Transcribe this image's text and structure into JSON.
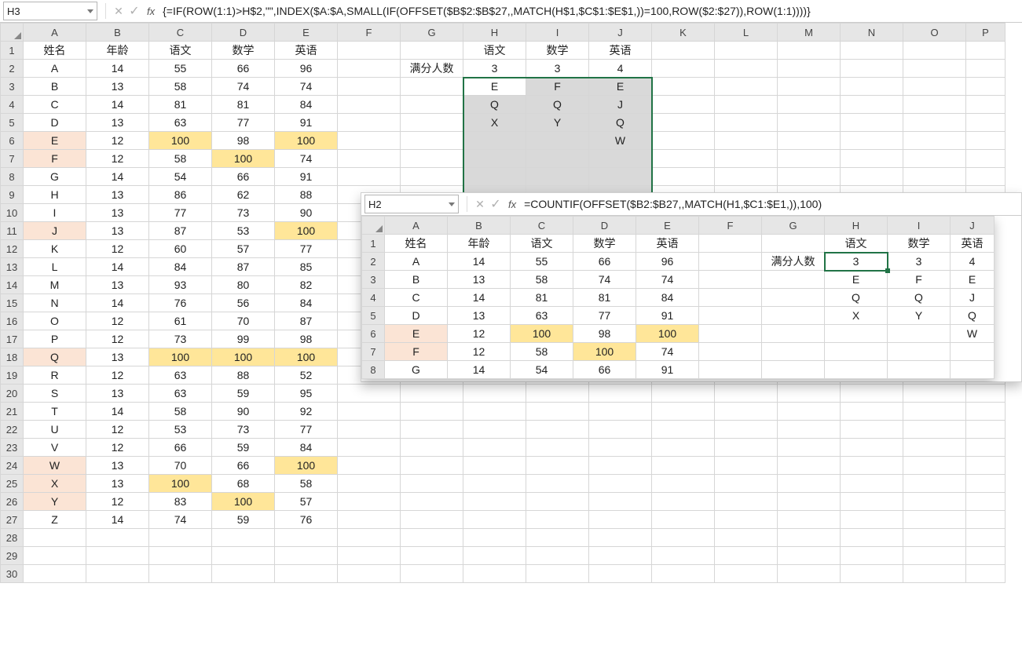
{
  "main": {
    "nameBox": "H3",
    "formula": "{=IF(ROW(1:1)>H$2,\"\",INDEX($A:$A,SMALL(IF(OFFSET($B$2:$B$27,,MATCH(H$1,$C$1:$E$1,))=100,ROW($2:$27)),ROW(1:1))))}",
    "columns": [
      "A",
      "B",
      "C",
      "D",
      "E",
      "F",
      "G",
      "H",
      "I",
      "J",
      "K",
      "L",
      "M",
      "N",
      "O",
      "P"
    ],
    "headerRow": {
      "A": "姓名",
      "B": "年龄",
      "C": "语文",
      "D": "数学",
      "E": "英语"
    },
    "outRow1": {
      "H": "语文",
      "I": "数学",
      "J": "英语"
    },
    "outRow2": {
      "G": "满分人数",
      "H": "3",
      "I": "3",
      "J": "4"
    },
    "outRow3": {
      "H": "E",
      "I": "F",
      "J": "E"
    },
    "outRow4": {
      "H": "Q",
      "I": "Q",
      "J": "J"
    },
    "outRow5": {
      "H": "X",
      "I": "Y",
      "J": "Q"
    },
    "outRow6": {
      "J": "W"
    },
    "rows": [
      {
        "A": "A",
        "B": "14",
        "C": "55",
        "D": "66",
        "E": "96"
      },
      {
        "A": "B",
        "B": "13",
        "C": "58",
        "D": "74",
        "E": "74"
      },
      {
        "A": "C",
        "B": "14",
        "C": "81",
        "D": "81",
        "E": "84"
      },
      {
        "A": "D",
        "B": "13",
        "C": "63",
        "D": "77",
        "E": "91"
      },
      {
        "A": "E",
        "B": "12",
        "C": "100",
        "D": "98",
        "E": "100",
        "hlName": true,
        "hlCols": [
          "C",
          "E"
        ]
      },
      {
        "A": "F",
        "B": "12",
        "C": "58",
        "D": "100",
        "E": "74",
        "hlName": true,
        "hlCols": [
          "D"
        ]
      },
      {
        "A": "G",
        "B": "14",
        "C": "54",
        "D": "66",
        "E": "91"
      },
      {
        "A": "H",
        "B": "13",
        "C": "86",
        "D": "62",
        "E": "88"
      },
      {
        "A": "I",
        "B": "13",
        "C": "77",
        "D": "73",
        "E": "90"
      },
      {
        "A": "J",
        "B": "13",
        "C": "87",
        "D": "53",
        "E": "100",
        "hlName": true,
        "hlCols": [
          "E"
        ]
      },
      {
        "A": "K",
        "B": "12",
        "C": "60",
        "D": "57",
        "E": "77"
      },
      {
        "A": "L",
        "B": "14",
        "C": "84",
        "D": "87",
        "E": "85"
      },
      {
        "A": "M",
        "B": "13",
        "C": "93",
        "D": "80",
        "E": "82"
      },
      {
        "A": "N",
        "B": "14",
        "C": "76",
        "D": "56",
        "E": "84"
      },
      {
        "A": "O",
        "B": "12",
        "C": "61",
        "D": "70",
        "E": "87"
      },
      {
        "A": "P",
        "B": "12",
        "C": "73",
        "D": "99",
        "E": "98"
      },
      {
        "A": "Q",
        "B": "13",
        "C": "100",
        "D": "100",
        "E": "100",
        "hlName": true,
        "hlCols": [
          "C",
          "D",
          "E"
        ]
      },
      {
        "A": "R",
        "B": "12",
        "C": "63",
        "D": "88",
        "E": "52"
      },
      {
        "A": "S",
        "B": "13",
        "C": "63",
        "D": "59",
        "E": "95"
      },
      {
        "A": "T",
        "B": "14",
        "C": "58",
        "D": "90",
        "E": "92"
      },
      {
        "A": "U",
        "B": "12",
        "C": "53",
        "D": "73",
        "E": "77"
      },
      {
        "A": "V",
        "B": "12",
        "C": "66",
        "D": "59",
        "E": "84"
      },
      {
        "A": "W",
        "B": "13",
        "C": "70",
        "D": "66",
        "E": "100",
        "hlName": true,
        "hlCols": [
          "E"
        ]
      },
      {
        "A": "X",
        "B": "13",
        "C": "100",
        "D": "68",
        "E": "58",
        "hlName": true,
        "hlCols": [
          "C"
        ]
      },
      {
        "A": "Y",
        "B": "12",
        "C": "83",
        "D": "100",
        "E": "57",
        "hlName": true,
        "hlCols": [
          "D"
        ]
      },
      {
        "A": "Z",
        "B": "14",
        "C": "74",
        "D": "59",
        "E": "76"
      }
    ]
  },
  "inset": {
    "nameBox": "H2",
    "formula": "=COUNTIF(OFFSET($B2:$B27,,MATCH(H1,$C1:$E1,)),100)",
    "columns": [
      "A",
      "B",
      "C",
      "D",
      "E",
      "F",
      "G",
      "H",
      "I",
      "J"
    ],
    "headerRow": {
      "A": "姓名",
      "B": "年龄",
      "C": "语文",
      "D": "数学",
      "E": "英语",
      "H": "语文",
      "I": "数学",
      "J": "英语"
    },
    "row2": {
      "A": "A",
      "B": "14",
      "C": "55",
      "D": "66",
      "E": "96",
      "G": "满分人数",
      "H": "3",
      "I": "3",
      "J": "4"
    },
    "row3": {
      "A": "B",
      "B": "13",
      "C": "58",
      "D": "74",
      "E": "74",
      "H": "E",
      "I": "F",
      "J": "E"
    },
    "row4": {
      "A": "C",
      "B": "14",
      "C": "81",
      "D": "81",
      "E": "84",
      "H": "Q",
      "I": "Q",
      "J": "J"
    },
    "row5": {
      "A": "D",
      "B": "13",
      "C": "63",
      "D": "77",
      "E": "91",
      "H": "X",
      "I": "Y",
      "J": "Q"
    },
    "row6": {
      "A": "E",
      "B": "12",
      "C": "100",
      "D": "98",
      "E": "100",
      "J": "W",
      "hlName": true,
      "hlCols": [
        "C",
        "E"
      ]
    },
    "row7": {
      "A": "F",
      "B": "12",
      "C": "58",
      "D": "100",
      "E": "74",
      "hlName": true,
      "hlCols": [
        "D"
      ]
    },
    "row8": {
      "A": "G",
      "B": "14",
      "C": "54",
      "D": "66",
      "E": "91"
    }
  }
}
